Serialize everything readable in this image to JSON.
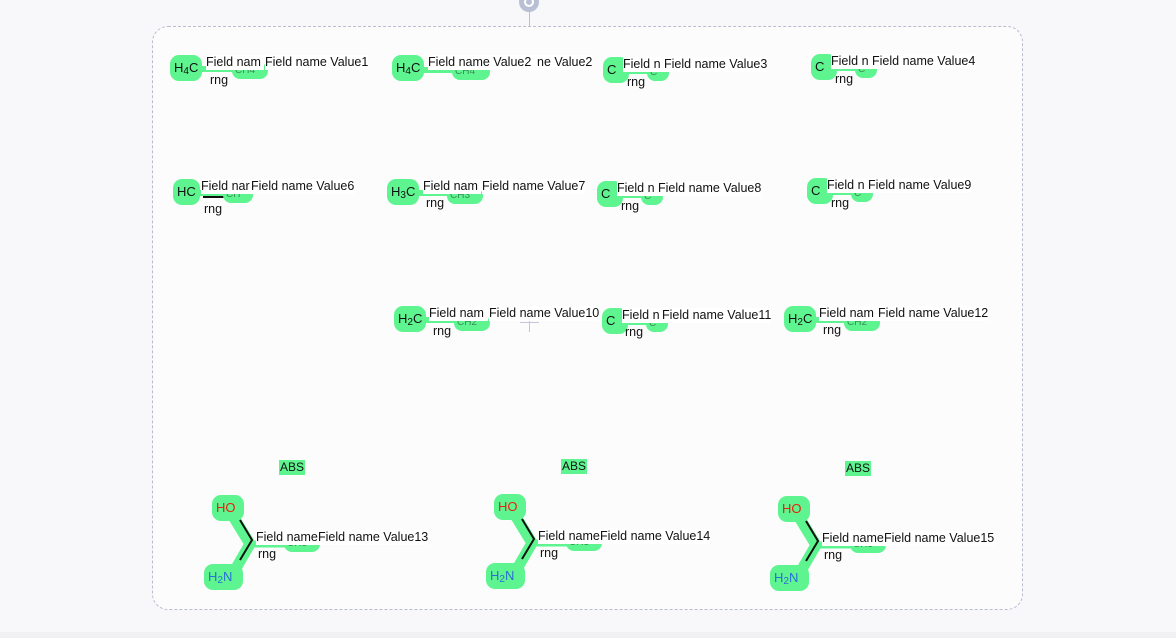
{
  "structures": [
    {
      "atom": "H4C",
      "atom_parts": [
        "H",
        "4",
        "C"
      ],
      "field_name": "Field nam",
      "field_value": "Field name Value1",
      "rng": "rng"
    },
    {
      "atom": "H4C",
      "atom_parts": [
        "H",
        "4",
        "C"
      ],
      "field_name": "Field name Value2",
      "field_value": "ne Value2",
      "rng": ""
    },
    {
      "atom": "C",
      "atom_parts": [
        "",
        "",
        "C"
      ],
      "field_name": "Field n",
      "field_value": "Field name Value3",
      "rng": "rng"
    },
    {
      "atom": "C",
      "atom_parts": [
        "",
        "",
        "C"
      ],
      "field_name": "Field n",
      "field_value": "Field name Value4",
      "rng": "rng"
    },
    {
      "atom": "HC",
      "atom_parts": [
        "H",
        "",
        "C"
      ],
      "field_name": "Field nar",
      "field_value": "Field name Value6",
      "rng": "rng"
    },
    {
      "atom": "H3C",
      "atom_parts": [
        "H",
        "3",
        "C"
      ],
      "field_name": "Field nam",
      "field_value": "Field name Value7",
      "rng": "rng"
    },
    {
      "atom": "C",
      "atom_parts": [
        "",
        "",
        "C"
      ],
      "field_name": "Field n",
      "field_value": "Field name Value8",
      "rng": "rng"
    },
    {
      "atom": "C",
      "atom_parts": [
        "",
        "",
        "C"
      ],
      "field_name": "Field n",
      "field_value": "Field name Value9",
      "rng": "rng"
    },
    {
      "atom": "H2C",
      "atom_parts": [
        "H",
        "2",
        "C"
      ],
      "field_name": "Field nam",
      "field_value": "Field name Value10",
      "rng": "rng"
    },
    {
      "atom": "C",
      "atom_parts": [
        "",
        "",
        "C"
      ],
      "field_name": "Field n",
      "field_value": "Field name Value11",
      "rng": "rng"
    },
    {
      "atom": "H2C",
      "atom_parts": [
        "H",
        "2",
        "C"
      ],
      "field_name": "Field nam",
      "field_value": "Field name Value12",
      "rng": "rng"
    }
  ],
  "amino_structures": [
    {
      "abs": "ABS",
      "ho": "HO",
      "nh2_parts": [
        "H",
        "2",
        "N"
      ],
      "field_name": "Field name",
      "field_value": "Field name Value13",
      "rng": "rng"
    },
    {
      "abs": "ABS",
      "ho": "HO",
      "nh2_parts": [
        "H",
        "2",
        "N"
      ],
      "field_name": "Field name",
      "field_value": "Field name Value14",
      "rng": "rng"
    },
    {
      "abs": "ABS",
      "ho": "HO",
      "nh2_parts": [
        "H",
        "2",
        "N"
      ],
      "field_name": "Field name",
      "field_value": "Field name Value15",
      "rng": "rng"
    }
  ],
  "colors": {
    "highlight": "#5ef590",
    "oxygen": "#e8220f",
    "nitrogen": "#2b6fd6",
    "frame": "#b8bcd0"
  }
}
